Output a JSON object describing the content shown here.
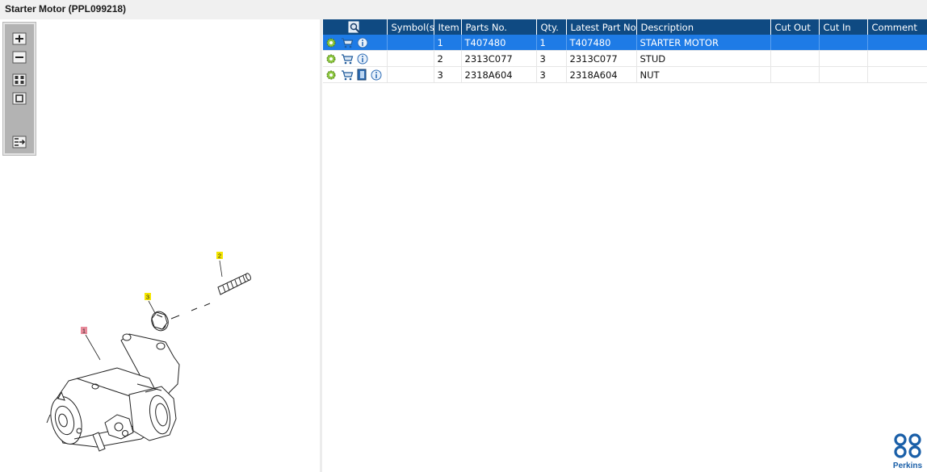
{
  "window": {
    "title": "Starter Motor (PPL099218)"
  },
  "toolbar": {
    "tools": [
      "zoom-in-icon",
      "zoom-out-icon",
      "grid-view-icon",
      "fit-page-icon",
      "export-list-icon"
    ]
  },
  "drawing": {
    "callouts": [
      "1",
      "2",
      "3"
    ]
  },
  "table": {
    "headers": [
      "",
      "Symbol(s)",
      "Item",
      "Parts No.",
      "Qty.",
      "Latest Part No.",
      "Description",
      "Cut Out",
      "Cut In",
      "Comment"
    ],
    "rows": [
      {
        "item": "1",
        "part_no": "T407480",
        "qty": "1",
        "latest_part_no": "T407480",
        "description": "STARTER MOTOR",
        "selected": true
      },
      {
        "item": "2",
        "part_no": "2313C077",
        "qty": "3",
        "latest_part_no": "2313C077",
        "description": "STUD",
        "selected": false
      },
      {
        "item": "3",
        "part_no": "2318A604",
        "qty": "3",
        "latest_part_no": "2318A604",
        "description": "NUT",
        "selected": false
      }
    ]
  },
  "brand": {
    "name": "Perkins"
  },
  "colors": {
    "header": "#0f4a82",
    "selected": "#1e7be6",
    "callout_yellow": "#f5e600",
    "callout_red": "#e88a9a"
  }
}
